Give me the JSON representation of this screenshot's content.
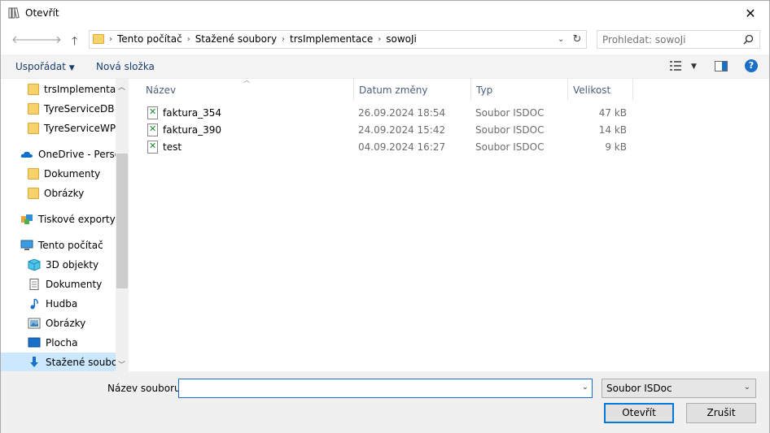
{
  "window": {
    "title": "Otevřít"
  },
  "address": {
    "crumbs": [
      "Tento počítač",
      "Stažené soubory",
      "trsImplementace",
      "sowoJi"
    ]
  },
  "search": {
    "placeholder": "Prohledat: sowoJi"
  },
  "toolbar": {
    "organize_label": "Uspořádat",
    "new_folder_label": "Nová složka"
  },
  "nav": {
    "items": [
      {
        "label": "trsImplementace",
        "icon": "folder-icon"
      },
      {
        "label": "TyreServiceDB",
        "icon": "folder-icon"
      },
      {
        "label": "TyreServiceWPF(",
        "icon": "folder-icon"
      },
      {
        "label": "OneDrive - Persor",
        "icon": "cloud-icon"
      },
      {
        "label": "Dokumenty",
        "icon": "folder-icon"
      },
      {
        "label": "Obrázky",
        "icon": "folder-icon"
      },
      {
        "label": "Tiskové exporty z",
        "icon": "print-export-icon"
      },
      {
        "label": "Tento počítač",
        "icon": "computer-icon"
      },
      {
        "label": "3D objekty",
        "icon": "cube-icon"
      },
      {
        "label": "Dokumenty",
        "icon": "document-icon"
      },
      {
        "label": "Hudba",
        "icon": "music-icon"
      },
      {
        "label": "Obrázky",
        "icon": "picture-icon"
      },
      {
        "label": "Plocha",
        "icon": "desktop-icon"
      },
      {
        "label": "Stažené soubory",
        "icon": "download-icon"
      }
    ]
  },
  "columns": {
    "name": "Název",
    "date": "Datum změny",
    "type": "Typ",
    "size": "Velikost"
  },
  "files": [
    {
      "name": "faktura_354",
      "date": "26.09.2024 18:54",
      "type": "Soubor ISDOC",
      "size": "47 kB"
    },
    {
      "name": "faktura_390",
      "date": "24.09.2024 15:42",
      "type": "Soubor ISDOC",
      "size": "14 kB"
    },
    {
      "name": "test",
      "date": "04.09.2024 16:27",
      "type": "Soubor ISDOC",
      "size": "9 kB"
    }
  ],
  "bottom": {
    "filename_label": "Název souboru:",
    "filename_value": "",
    "filetype": "Soubor ISDoc",
    "open_label": "Otevřít",
    "cancel_label": "Zrušit"
  },
  "colors": {
    "accent": "#0078d7",
    "selection": "#cce8ff",
    "link": "#1a3e6e"
  }
}
